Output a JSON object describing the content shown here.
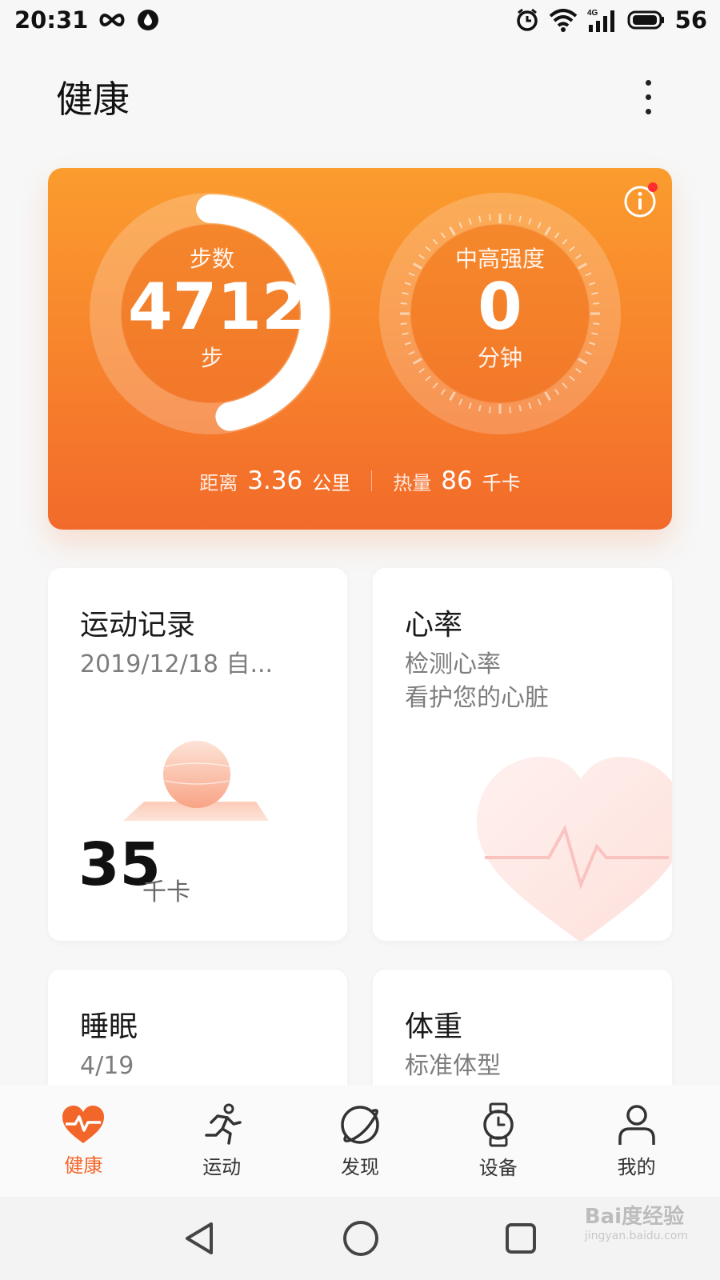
{
  "status_bar": {
    "time": "20:31",
    "battery": "56",
    "network": "4G"
  },
  "header": {
    "title": "健康"
  },
  "summary": {
    "steps": {
      "label": "步数",
      "value": "4712",
      "unit": "步",
      "progress": 0.47
    },
    "intensity": {
      "label": "中高强度",
      "value": "0",
      "unit": "分钟",
      "progress": 0
    },
    "distance": {
      "label": "距离",
      "value": "3.36",
      "unit": "公里"
    },
    "calories": {
      "label": "热量",
      "value": "86",
      "unit": "千卡"
    }
  },
  "cards": {
    "exercise": {
      "title": "运动记录",
      "subtitle": "2019/12/18 自...",
      "value": "35",
      "unit": "千卡"
    },
    "heart_rate": {
      "title": "心率",
      "line1": "检测心率",
      "line2": "看护您的心脏"
    },
    "sleep": {
      "title": "睡眠",
      "subtitle": "4/19"
    },
    "weight": {
      "title": "体重",
      "subtitle": "标准体型"
    }
  },
  "tabs": [
    {
      "label": "健康",
      "icon": "heart-pulse-icon",
      "active": true
    },
    {
      "label": "运动",
      "icon": "running-icon",
      "active": false
    },
    {
      "label": "发现",
      "icon": "planet-icon",
      "active": false
    },
    {
      "label": "设备",
      "icon": "watch-icon",
      "active": false
    },
    {
      "label": "我的",
      "icon": "person-icon",
      "active": false
    }
  ],
  "colors": {
    "accent": "#f2662a",
    "card_top": "#fb9c2e",
    "card_bottom": "#f26a2a"
  },
  "watermark": {
    "brand": "Bai度经验",
    "url": "jingyan.baidu.com"
  }
}
